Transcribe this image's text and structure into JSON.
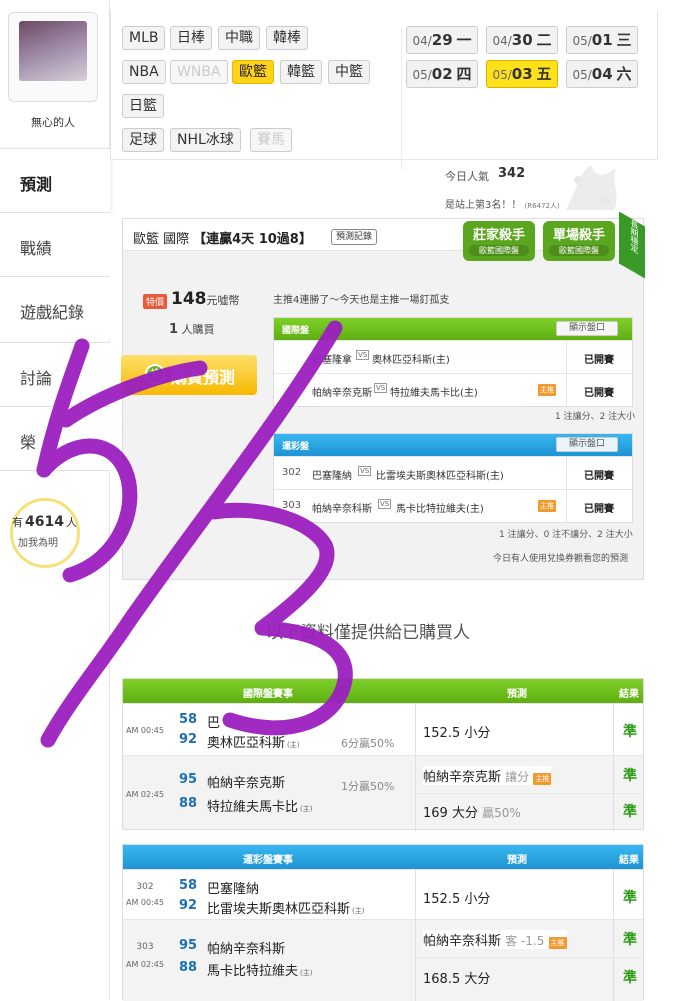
{
  "sidebar": {
    "username": "無心的人",
    "nav": [
      "預測",
      "戰績",
      "遊戲紀錄",
      "討論",
      "榮"
    ],
    "popularity_prefix": "有",
    "popularity_count": "4614",
    "popularity_suffix": "人",
    "popularity_sub": "加我為明"
  },
  "leagues": {
    "row1": [
      "MLB",
      "日棒",
      "中職",
      "韓棒"
    ],
    "row2": [
      "NBA",
      "WNBA",
      "歐籃",
      "韓籃",
      "中籃"
    ],
    "row3": [
      "日籃"
    ],
    "row4": [
      "足球",
      "NHL冰球",
      "賽馬"
    ],
    "disabled": [
      "WNBA",
      "賽馬"
    ],
    "active": "歐籃"
  },
  "dates": [
    {
      "md": "04/",
      "d": "29",
      "w": "一"
    },
    {
      "md": "04/",
      "d": "30",
      "w": "二"
    },
    {
      "md": "05/",
      "d": "01",
      "w": "三"
    },
    {
      "md": "05/",
      "d": "02",
      "w": "四"
    },
    {
      "md": "05/",
      "d": "03",
      "w": "五"
    },
    {
      "md": "05/",
      "d": "04",
      "w": "六"
    }
  ],
  "active_date_index": 4,
  "stats": {
    "today_pop_label": "今日人氣",
    "today_pop_value": "342",
    "rank_text": "是站上第3名！！",
    "rank_small": "(R6472人)"
  },
  "card": {
    "league": "歐籃 國際",
    "streak": "【連贏4天 10過8】",
    "record_btn": "預測記錄",
    "badge1_title": "莊家殺手",
    "badge1_sub": "歐籃國際盤",
    "badge2_title": "單場殺手",
    "badge2_sub": "歐籃國際盤",
    "ribbon": "長期穩定",
    "price_tag": "特價",
    "price": "148",
    "price_unit": "元噓幣",
    "buyers": "1",
    "buyers_suffix": "人購買",
    "buy_button": "購買預測",
    "buy_icon": "搶",
    "comment": "主推4連勝了～今天也是主推一場釘孤支"
  },
  "intl_preview": {
    "header": "國際盤",
    "show_btn": "顯示盤口",
    "rows": [
      {
        "home": "巴塞隆拿",
        "away": "奧林匹亞科斯(主)",
        "status": "已開賽",
        "master": false
      },
      {
        "home": "帕納辛奈克斯",
        "away": "特拉維夫馬卡比(主)",
        "status": "已開賽",
        "master": true
      }
    ],
    "note": "1 注讓分、2 注大小"
  },
  "lottery_preview": {
    "header": "運彩盤",
    "show_btn": "顯示盤口",
    "rows": [
      {
        "num": "302",
        "home": "巴塞隆納",
        "away": "比雷埃夫斯奧林匹亞科斯(主)",
        "status": "已開賽",
        "master": false
      },
      {
        "num": "303",
        "home": "帕納辛奈科斯",
        "away": "馬卡比特拉維夫(主)",
        "status": "已開賽",
        "master": true
      }
    ],
    "note": "1 注讓分、0 注不讓分、2 注大小",
    "note2": "今日有人使用兌換券觀看您的預測"
  },
  "section_title": "以下資料僅提供給已購買人",
  "results_intl": {
    "head_match": "國際盤賽事",
    "head_pick": "預測",
    "head_result": "結果",
    "rows": [
      {
        "time": "AM 00:45",
        "n1": "58",
        "t1": "巴",
        "n2": "92",
        "t2": "奧林匹亞科斯",
        "t2tag": "(主)",
        "odds": "6分贏50%",
        "picks": [
          {
            "text": "152.5 小分",
            "extra": "",
            "master": false,
            "result": "準"
          }
        ]
      },
      {
        "time": "AM 02:45",
        "n1": "95",
        "t1": "帕納辛奈克斯",
        "n2": "88",
        "t2": "特拉維夫馬卡比",
        "t2tag": "(主)",
        "odds": "1分贏50%",
        "picks": [
          {
            "text": "帕納辛奈克斯",
            "extra": "讓分",
            "master": true,
            "result": "準"
          },
          {
            "text": "169 大分",
            "extra": "贏50%",
            "master": false,
            "result": "準"
          }
        ]
      }
    ]
  },
  "results_lottery": {
    "head_match": "運彩盤賽事",
    "head_pick": "預測",
    "head_result": "結果",
    "rows": [
      {
        "num": "302",
        "time": "AM 00:45",
        "n1": "58",
        "t1": "巴塞隆納",
        "n2": "92",
        "t2": "比雷埃夫斯奧林匹亞科斯",
        "t2tag": "(主)",
        "picks": [
          {
            "text": "152.5 小分",
            "extra": "",
            "master": false,
            "result": "準"
          }
        ]
      },
      {
        "num": "303",
        "time": "AM 02:45",
        "n1": "95",
        "t1": "帕納辛奈科斯",
        "n2": "88",
        "t2": "馬卡比特拉維夫",
        "t2tag": "(主)",
        "picks": [
          {
            "text": "帕納辛奈科斯",
            "extra": "客 -1.5",
            "master": true,
            "result": "準"
          },
          {
            "text": "168.5 大分",
            "extra": "",
            "master": false,
            "result": "準"
          }
        ]
      }
    ]
  },
  "master_label": "主推",
  "vs_label": "VS",
  "handwriting": "5/3",
  "colors": {
    "green": "#5fae12",
    "blue": "#1d94d4",
    "yellow": "#ffd21a",
    "scribble": "#9b1fbf"
  }
}
